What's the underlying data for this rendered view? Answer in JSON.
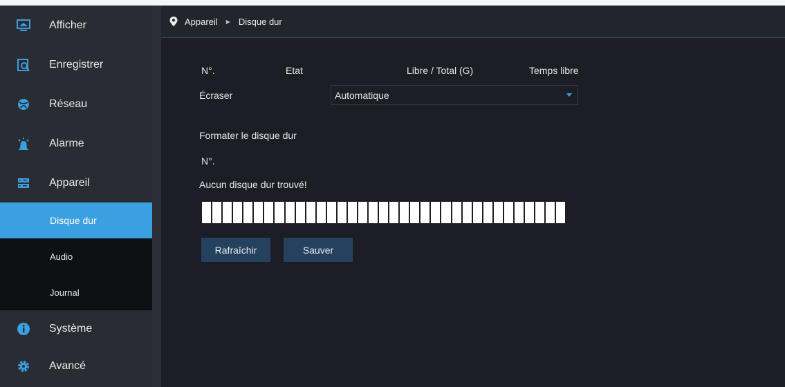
{
  "sidebar": {
    "items": [
      {
        "label": "Afficher",
        "icon": "monitor-icon"
      },
      {
        "label": "Enregistrer",
        "icon": "record-search-icon"
      },
      {
        "label": "Réseau",
        "icon": "globe-icon"
      },
      {
        "label": "Alarme",
        "icon": "alarm-icon"
      },
      {
        "label": "Appareil",
        "icon": "device-icon"
      }
    ],
    "sub_items": [
      {
        "label": "Disque dur",
        "active": true
      },
      {
        "label": "Audio",
        "active": false
      },
      {
        "label": "Journal",
        "active": false
      }
    ],
    "bottom_items": [
      {
        "label": "Système",
        "icon": "info-icon"
      },
      {
        "label": "Avancé",
        "icon": "gear-icon"
      }
    ]
  },
  "breadcrumb": {
    "parent": "Appareil",
    "current": "Disque dur"
  },
  "table": {
    "headers": [
      "N°.",
      "Etat",
      "Libre / Total (G)",
      "Temps libre"
    ]
  },
  "overwrite": {
    "label": "Écraser",
    "value": "Automatique"
  },
  "format": {
    "title": "Formater le disque dur",
    "no_label": "N°.",
    "message": "Aucun disque dur trouvé!"
  },
  "buttons": {
    "refresh": "Rafraîchir",
    "save": "Sauver"
  },
  "colors": {
    "accent": "#3aa0e0",
    "button": "#24415f",
    "sidebar": "#2a2c33",
    "background": "#1d1e25"
  }
}
